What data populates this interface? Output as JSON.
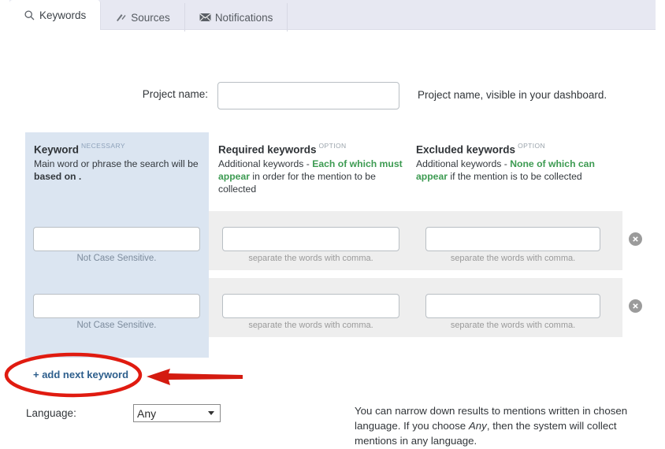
{
  "tabs": [
    {
      "label": "Keywords",
      "icon": "search-icon",
      "active": true
    },
    {
      "label": "Sources",
      "icon": "feed-icon",
      "active": false
    },
    {
      "label": "Notifications",
      "icon": "envelope-icon",
      "active": false
    }
  ],
  "project": {
    "label": "Project name:",
    "value": "",
    "placeholder": "",
    "hint": "Project name, visible in your dashboard."
  },
  "columns": {
    "keyword": {
      "title": "Keyword",
      "badge": "NECESSARY",
      "desc_1": "Main word or phrase the search will be",
      "desc_2": "based on ."
    },
    "required": {
      "title": "Required keywords",
      "badge": "OPTION",
      "desc_pre": "Additional keywords - ",
      "desc_green": "Each of which must appear",
      "desc_post": " in order for the mention to be collected"
    },
    "excluded": {
      "title": "Excluded keywords",
      "badge": "OPTION",
      "desc_pre": "Additional keywords - ",
      "desc_green": "None of which can appear",
      "desc_post": " if the mention is to be collected"
    }
  },
  "hints": {
    "not_case_sensitive": "Not Case Sensitive.",
    "comma": "separate the words with comma."
  },
  "rows": [
    {
      "keyword": "",
      "required": "",
      "excluded": "",
      "remove_icon": "remove-circle-icon"
    },
    {
      "keyword": "",
      "required": "",
      "excluded": "",
      "remove_icon": "remove-circle-icon"
    }
  ],
  "add_link": {
    "label": "+ add next keyword"
  },
  "language": {
    "label": "Language:",
    "selected": "Any",
    "options": [
      "Any"
    ],
    "hint_1": "You can narrow down results to mentions written in chosen",
    "hint_2a": "language. If you choose ",
    "hint_2b": "Any",
    "hint_2c": ", then the system will collect",
    "hint_3": "mentions in any language."
  },
  "annotations": {
    "ellipse_color": "#e01b10",
    "arrow_color": "#d41b10"
  },
  "colors": {
    "keyword_panel": "#dbe5f1",
    "row_panel": "#eeeeee",
    "tabstrip": "#e7e8f2",
    "green": "#3d9b52",
    "link": "#2d5e8c"
  }
}
